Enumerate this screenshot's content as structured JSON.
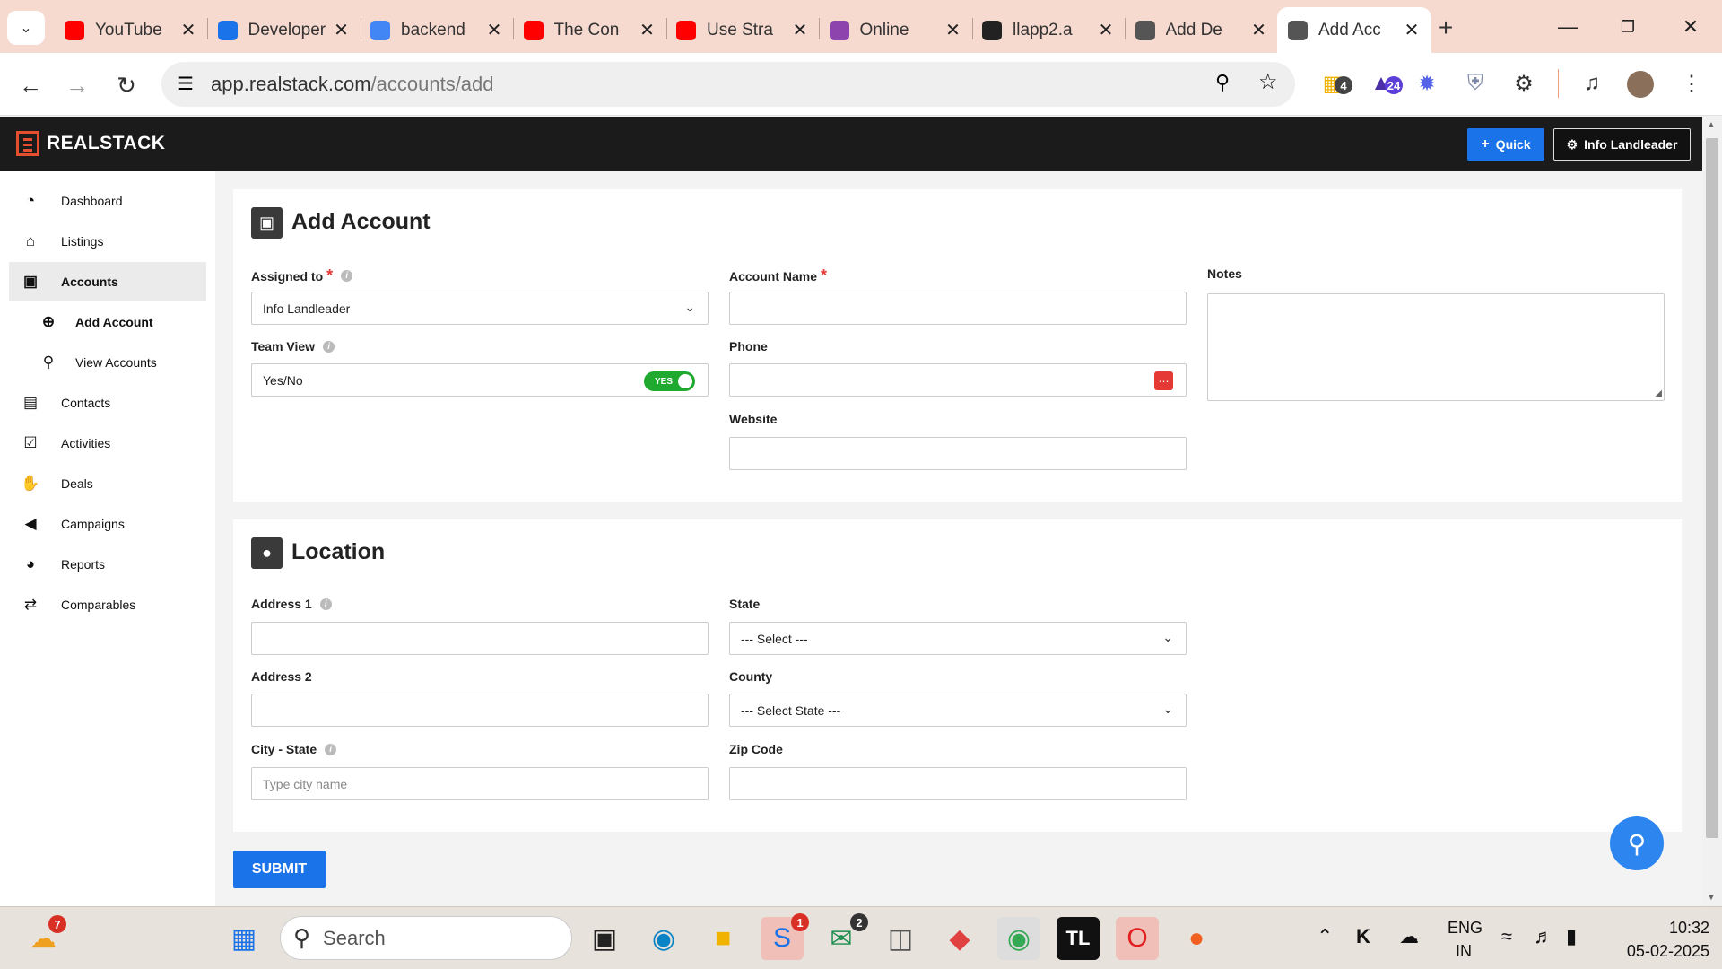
{
  "browser": {
    "tabs": [
      {
        "title": "YouTube",
        "color": "#ff0000",
        "icon": "youtube-icon"
      },
      {
        "title": "Developers",
        "color": "#1a73e8",
        "icon": "postman-icon"
      },
      {
        "title": "backend",
        "color": "#4285f4",
        "icon": "google-icon"
      },
      {
        "title": "The Con",
        "color": "#ff0000",
        "icon": "youtube-icon"
      },
      {
        "title": "Use Stra",
        "color": "#ff0000",
        "icon": "youtube-icon"
      },
      {
        "title": "Online",
        "color": "#8e44ad",
        "icon": "online-icon"
      },
      {
        "title": "llapp2.a",
        "color": "#222222",
        "icon": "app-icon"
      },
      {
        "title": "Add De",
        "color": "#555555",
        "icon": "page-icon"
      },
      {
        "title": "Add Acc",
        "color": "#555555",
        "icon": "page-icon",
        "active": true
      }
    ],
    "url_host": "app.realstack.com",
    "url_path": "/accounts/add",
    "ext_badge_1": "4",
    "ext_badge_2": "24"
  },
  "app": {
    "brand": "REALSTACK",
    "quick_label": "Quick",
    "user_label": "Info Landleader",
    "sidebar": [
      {
        "label": "Dashboard",
        "icon": "dashboard-icon"
      },
      {
        "label": "Listings",
        "icon": "home-icon"
      },
      {
        "label": "Accounts",
        "icon": "briefcase-icon",
        "active": true
      },
      {
        "label": "Add Account",
        "icon": "plus-circle-icon",
        "sub": true,
        "bold": true
      },
      {
        "label": "View Accounts",
        "icon": "search-icon",
        "sub": true
      },
      {
        "label": "Contacts",
        "icon": "contact-icon"
      },
      {
        "label": "Activities",
        "icon": "calendar-check-icon"
      },
      {
        "label": "Deals",
        "icon": "hand-coin-icon"
      },
      {
        "label": "Campaigns",
        "icon": "megaphone-icon"
      },
      {
        "label": "Reports",
        "icon": "pie-chart-icon"
      },
      {
        "label": "Comparables",
        "icon": "compare-icon"
      }
    ],
    "account_section": {
      "title": "Add Account",
      "assigned_to_label": "Assigned to",
      "assigned_to_value": "Info Landleader",
      "team_view_label": "Team View",
      "team_view_value": "Yes/No",
      "toggle_label": "YES",
      "account_name_label": "Account Name",
      "phone_label": "Phone",
      "website_label": "Website",
      "notes_label": "Notes"
    },
    "location_section": {
      "title": "Location",
      "address1_label": "Address 1",
      "address2_label": "Address 2",
      "city_state_label": "City - State",
      "city_state_placeholder": "Type city name",
      "state_label": "State",
      "state_value": "--- Select ---",
      "county_label": "County",
      "county_value": "--- Select State ---",
      "zip_label": "Zip Code"
    },
    "submit_label": "SUBMIT"
  },
  "taskbar": {
    "search_placeholder": "Search",
    "widget_badge": "7",
    "skype_badge": "1",
    "chat_badge": "2",
    "lang_top": "ENG",
    "lang_bottom": "IN",
    "time": "10:32",
    "date": "05-02-2025"
  }
}
